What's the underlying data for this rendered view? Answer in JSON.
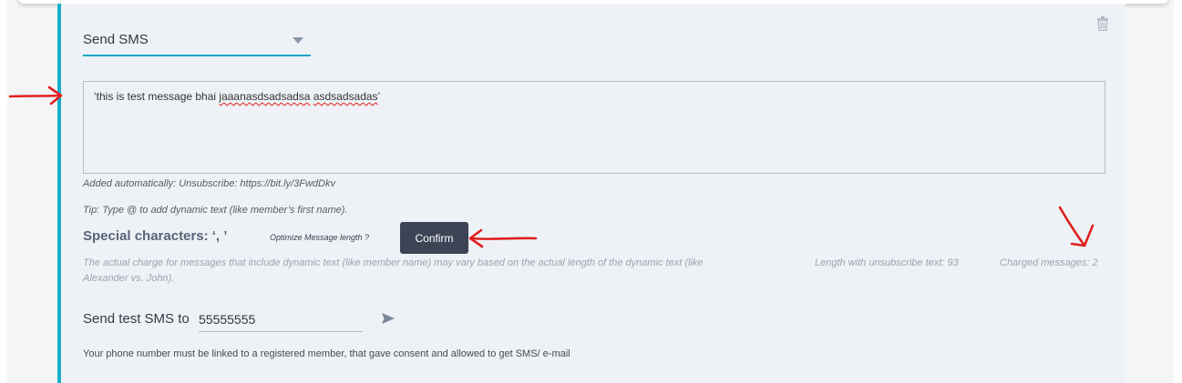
{
  "action_select": {
    "value": "Send SMS"
  },
  "message": {
    "segments": [
      {
        "text": "‘this is test message bhai ",
        "misspelled": false
      },
      {
        "text": "jaaanasdsadsadsa",
        "misspelled": true
      },
      {
        "text": " ",
        "misspelled": false
      },
      {
        "text": "asdsadsadas",
        "misspelled": true
      },
      {
        "text": "’",
        "misspelled": false
      }
    ]
  },
  "unsubscribe_note": "Added automatically: Unsubscribe: https://bit.ly/3FwdDkv",
  "tip": "Tip: Type @ to add dynamic text (like member’s first name).",
  "special_characters": "Special characters: ‘, ’",
  "optimize_label": "Optimize Message length ?",
  "confirm_label": "Confirm",
  "dynamic_charge_note": "The actual charge for messages that include dynamic text (like member name) may vary based on the actual length of the dynamic text (like Alexander vs. John).",
  "length_text": "Length with unsubscribe text: 93",
  "charged_text": "Charged messages: 2",
  "test_sms": {
    "label": "Send test SMS to",
    "phone": "55555555"
  },
  "footnote": "Your phone number must be linked to a registered member, that gave consent and allowed to get SMS/ e-mail",
  "colors": {
    "accent": "#19aecb",
    "button": "#3d4455",
    "annotation": "#e02020"
  },
  "icons": [
    "trash-icon",
    "send-icon"
  ]
}
